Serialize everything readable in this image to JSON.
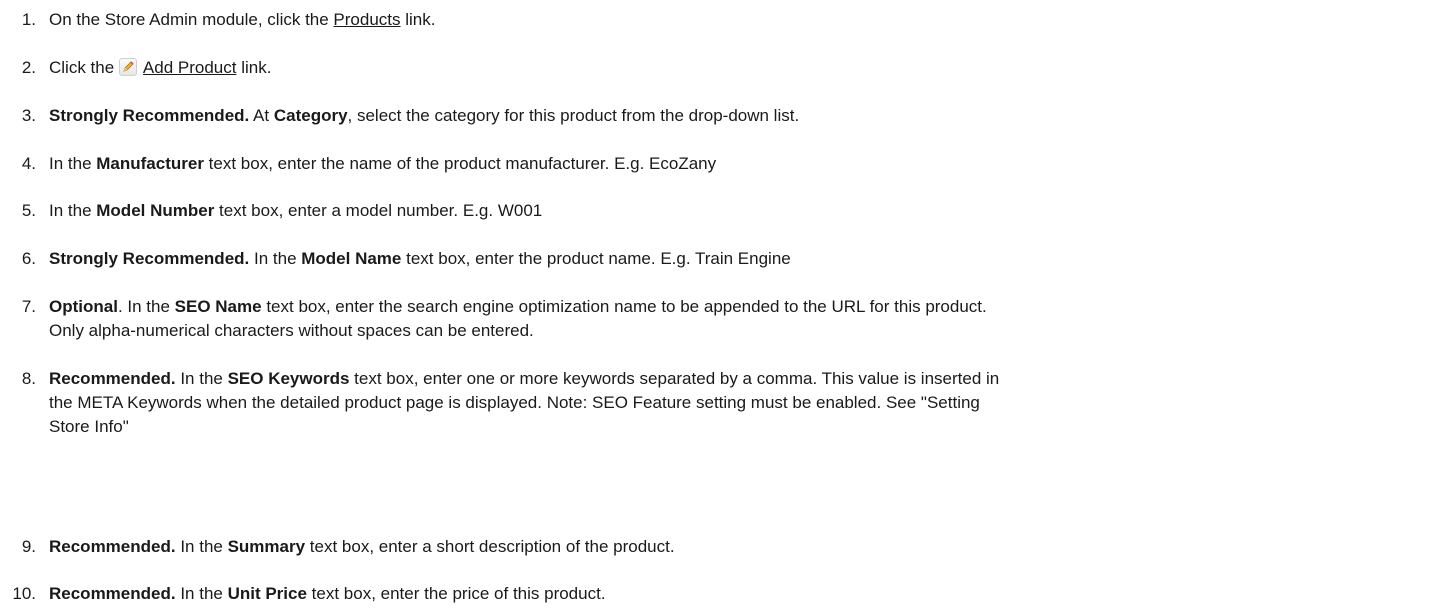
{
  "steps": [
    {
      "num": "1.",
      "t1": "On the Store Admin module, click the ",
      "link": "Products",
      "t2": " link."
    },
    {
      "num": "2.",
      "t1": "Click the ",
      "icon": "pencil-edit-icon",
      "link": "Add Product",
      "t2": " link."
    },
    {
      "num": "3.",
      "b1": "Strongly Recommended.",
      "t1": " At ",
      "b2": "Category",
      "t2": ", select the category for this product from the drop-down list."
    },
    {
      "num": "4.",
      "t1": "In the ",
      "b1": "Manufacturer",
      "t2": " text box, enter the name of the product manufacturer. E.g. EcoZany"
    },
    {
      "num": "5.",
      "t1": "In the ",
      "b1": "Model Number",
      "t2": " text box, enter a model number. E.g. W001"
    },
    {
      "num": "6.",
      "b1": "Strongly Recommended.",
      "t1": " In the ",
      "b2": "Model Name",
      "t2": " text box, enter the product name. E.g. Train Engine"
    },
    {
      "num": "7.",
      "b1": "Optional",
      "t1": ". In the ",
      "b2": "SEO Name",
      "t2": " text box, enter the search engine optimization name to be appended to the URL for this product.",
      "l2": "Only alpha-numerical characters without spaces can be entered."
    },
    {
      "num": "8.",
      "b1": "Recommended.",
      "t1": " In the ",
      "b2": "SEO Keywords",
      "t2": " text box, enter one or more keywords separated by a comma. This value is inserted in",
      "l2": "the META Keywords when the detailed product page is displayed. Note: SEO Feature setting must be enabled. See \"Setting",
      "l3": "Store Info\""
    },
    {
      "num": "9.",
      "b1": "Recommended.",
      "t1": " In the ",
      "b2": "Summary",
      "t2": " text box, enter a short description of the product."
    },
    {
      "num": "10.",
      "b1": "Recommended.",
      "t1": " In the ",
      "b2": "Unit Price",
      "t2": " text box, enter the price of this product."
    }
  ]
}
